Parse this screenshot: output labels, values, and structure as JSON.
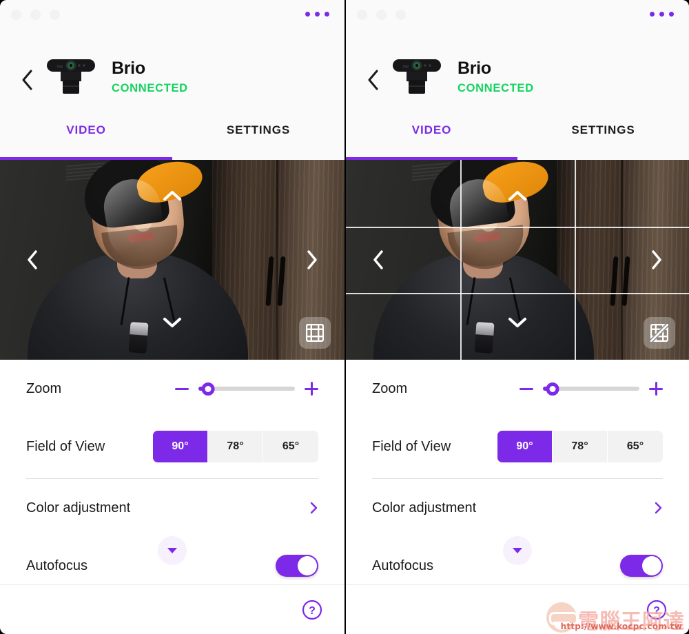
{
  "window": {
    "traffic_lights": [
      "close",
      "minimize",
      "zoom"
    ]
  },
  "header": {
    "menu_icon": "more-horizontal-icon",
    "back_icon": "chevron-left-icon",
    "device_image": "logitech-brio-webcam",
    "device_name": "Brio",
    "device_status": "CONNECTED",
    "status_color": "#12d45e",
    "accent_color": "#7d2ae8"
  },
  "tabs": [
    {
      "label": "VIDEO",
      "active": true
    },
    {
      "label": "SETTINGS",
      "active": false
    }
  ],
  "video": {
    "prev_icon": "chevron-left-icon",
    "next_icon": "chevron-right-icon",
    "pan_up_icon": "chevron-up-icon",
    "pan_down_icon": "chevron-down-icon",
    "grid_button_left": {
      "icon": "grid-on-icon",
      "grid_visible": false
    },
    "grid_button_right": {
      "icon": "grid-off-icon",
      "grid_visible": true
    }
  },
  "controls": {
    "zoom": {
      "label": "Zoom",
      "minus_icon": "minus-icon",
      "plus_icon": "plus-icon",
      "value_percent": 10
    },
    "field_of_view": {
      "label": "Field of View",
      "options": [
        "90°",
        "78°",
        "65°"
      ],
      "selected": "90°"
    },
    "color_adjustment": {
      "label": "Color adjustment",
      "chevron_icon": "chevron-right-icon"
    },
    "scroll_down": {
      "icon": "caret-down-icon"
    },
    "autofocus": {
      "label": "Autofocus",
      "enabled": true
    }
  },
  "bottom_bar": {
    "help_icon": "help-circle-icon"
  },
  "watermark": {
    "text": "電腦王阿達",
    "url": "http://www.kocpc.com.tw"
  }
}
